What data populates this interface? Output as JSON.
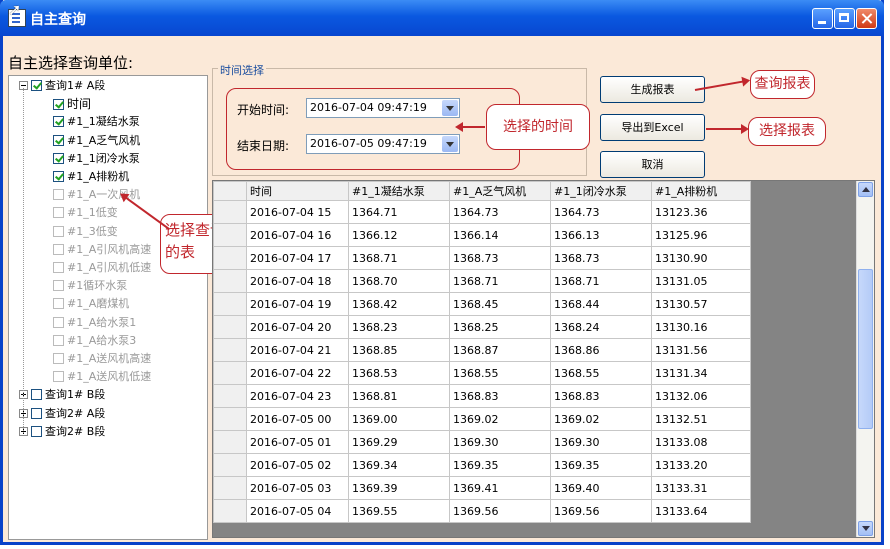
{
  "window": {
    "title": "自主查询"
  },
  "left": {
    "heading": "自主选择查询单位:",
    "tree": [
      {
        "label": "查询1# A段",
        "checked": true,
        "level": 0,
        "expander": "minus"
      },
      {
        "label": "时间",
        "checked": true,
        "level": 1
      },
      {
        "label": "#1_1凝结水泵",
        "checked": true,
        "level": 1
      },
      {
        "label": "#1_A乏气风机",
        "checked": true,
        "level": 1
      },
      {
        "label": "#1_1闭冷水泵",
        "checked": true,
        "level": 1
      },
      {
        "label": "#1_A排粉机",
        "checked": true,
        "level": 1
      },
      {
        "label": "#1_A一次风机",
        "checked": false,
        "level": 1
      },
      {
        "label": "#1_1低变",
        "checked": false,
        "level": 1
      },
      {
        "label": "#1_3低变",
        "checked": false,
        "level": 1
      },
      {
        "label": "#1_A引风机高速",
        "checked": false,
        "level": 1
      },
      {
        "label": "#1_A引风机低速",
        "checked": false,
        "level": 1
      },
      {
        "label": "#1循环水泵",
        "checked": false,
        "level": 1
      },
      {
        "label": "#1_A磨煤机",
        "checked": false,
        "level": 1
      },
      {
        "label": "#1_A给水泵1",
        "checked": false,
        "level": 1
      },
      {
        "label": "#1_A给水泵3",
        "checked": false,
        "level": 1
      },
      {
        "label": "#1_A送风机高速",
        "checked": false,
        "level": 1
      },
      {
        "label": "#1_A送风机低速",
        "checked": false,
        "level": 1
      },
      {
        "label": "查询1# B段",
        "checked": false,
        "level": 0,
        "expander": "plus"
      },
      {
        "label": "查询2# A段",
        "checked": false,
        "level": 0,
        "expander": "plus"
      },
      {
        "label": "查询2# B段",
        "checked": false,
        "level": 0,
        "expander": "plus"
      }
    ]
  },
  "time_group": {
    "title": "时间选择",
    "start_label": "开始时间:",
    "start_value": "2016-07-04 09:47:19",
    "end_label": "结束日期:",
    "end_value": "2016-07-05 09:47:19"
  },
  "buttons": {
    "generate": "生成报表",
    "export": "导出到Excel",
    "cancel": "取消"
  },
  "annotations": {
    "query_table": "查询报表",
    "selected_time": "选择的时间",
    "select_table": "选择报表",
    "select_query_table_1": "选择查询",
    "select_query_table_2": "的表"
  },
  "grid": {
    "columns": [
      "时间",
      "#1_1凝结水泵",
      "#1_A乏气风机",
      "#1_1闭冷水泵",
      "#1_A排粉机"
    ],
    "rows": [
      [
        "2016-07-04 15",
        "1364.71",
        "1364.73",
        "1364.73",
        "13123.36"
      ],
      [
        "2016-07-04 16",
        "1366.12",
        "1366.14",
        "1366.13",
        "13125.96"
      ],
      [
        "2016-07-04 17",
        "1368.71",
        "1368.73",
        "1368.73",
        "13130.90"
      ],
      [
        "2016-07-04 18",
        "1368.70",
        "1368.71",
        "1368.71",
        "13131.05"
      ],
      [
        "2016-07-04 19",
        "1368.42",
        "1368.45",
        "1368.44",
        "13130.57"
      ],
      [
        "2016-07-04 20",
        "1368.23",
        "1368.25",
        "1368.24",
        "13130.16"
      ],
      [
        "2016-07-04 21",
        "1368.85",
        "1368.87",
        "1368.86",
        "13131.56"
      ],
      [
        "2016-07-04 22",
        "1368.53",
        "1368.55",
        "1368.55",
        "13131.34"
      ],
      [
        "2016-07-04 23",
        "1368.81",
        "1368.83",
        "1368.83",
        "13132.06"
      ],
      [
        "2016-07-05 00",
        "1369.00",
        "1369.02",
        "1369.02",
        "13132.51"
      ],
      [
        "2016-07-05 01",
        "1369.29",
        "1369.30",
        "1369.30",
        "13133.08"
      ],
      [
        "2016-07-05 02",
        "1369.34",
        "1369.35",
        "1369.35",
        "13133.20"
      ],
      [
        "2016-07-05 03",
        "1369.39",
        "1369.41",
        "1369.40",
        "13133.31"
      ],
      [
        "2016-07-05 04",
        "1369.55",
        "1369.56",
        "1369.56",
        "13133.64"
      ]
    ]
  },
  "colors": {
    "title_bar": "#0a58e0",
    "annotation": "#c1272d",
    "window_bg": "#fbe9d8"
  }
}
